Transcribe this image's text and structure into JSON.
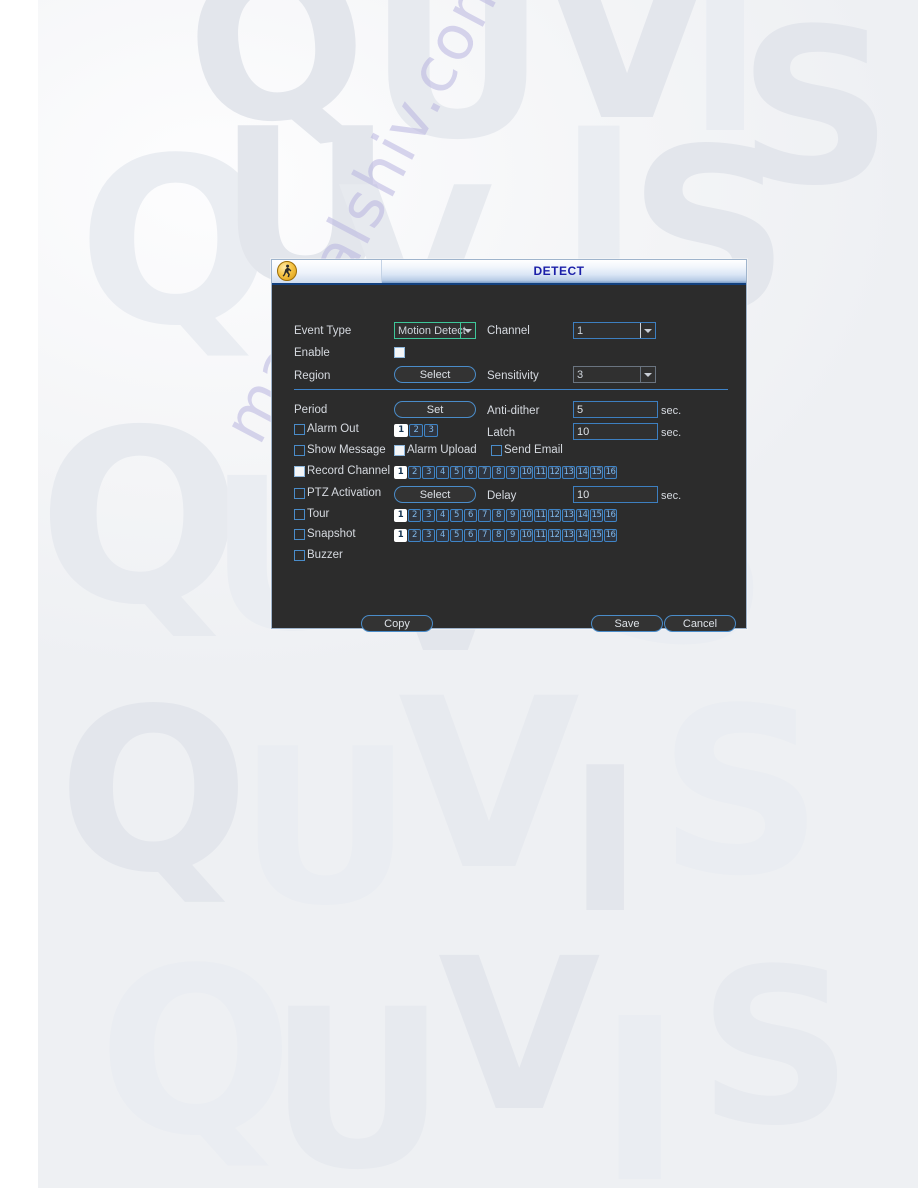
{
  "window": {
    "title": "DETECT",
    "icon": "walking-person-icon",
    "accent_blue": "#3d7fc0",
    "title_text_color": "#1b1fa8",
    "body_bg": "#2c2c2c"
  },
  "page": {
    "background_watermark_text": "QUVIS",
    "site_watermark_text": "manualshiv.com"
  },
  "form": {
    "event_type": {
      "label": "Event Type",
      "value": "Motion Detect"
    },
    "channel": {
      "label": "Channel",
      "value": "1"
    },
    "enable": {
      "label": "Enable",
      "checked": true
    },
    "region": {
      "label": "Region",
      "button": "Select"
    },
    "sensitivity": {
      "label": "Sensitivity",
      "value": "3"
    },
    "period": {
      "label": "Period",
      "button": "Set"
    },
    "anti_dither": {
      "label": "Anti-dither",
      "value": "5",
      "unit": "sec."
    },
    "alarm_out": {
      "label": "Alarm Out",
      "checked": false,
      "channels": [
        "1",
        "2",
        "3"
      ],
      "active": [
        1
      ]
    },
    "latch": {
      "label": "Latch",
      "value": "10",
      "unit": "sec."
    },
    "show_message": {
      "label": "Show Message",
      "checked": false
    },
    "alarm_upload": {
      "label": "Alarm Upload",
      "checked": true
    },
    "send_email": {
      "label": "Send Email",
      "checked": false
    },
    "record_channel": {
      "label": "Record Channel",
      "checked": true,
      "channels": [
        "1",
        "2",
        "3",
        "4",
        "5",
        "6",
        "7",
        "8",
        "9",
        "10",
        "11",
        "12",
        "13",
        "14",
        "15",
        "16"
      ],
      "active": [
        1
      ]
    },
    "ptz_activation": {
      "label": "PTZ Activation",
      "checked": false,
      "button": "Select"
    },
    "delay": {
      "label": "Delay",
      "value": "10",
      "unit": "sec."
    },
    "tour": {
      "label": "Tour",
      "checked": false,
      "channels": [
        "1",
        "2",
        "3",
        "4",
        "5",
        "6",
        "7",
        "8",
        "9",
        "10",
        "11",
        "12",
        "13",
        "14",
        "15",
        "16"
      ],
      "active": [
        1
      ]
    },
    "snapshot": {
      "label": "Snapshot",
      "checked": false,
      "channels": [
        "1",
        "2",
        "3",
        "4",
        "5",
        "6",
        "7",
        "8",
        "9",
        "10",
        "11",
        "12",
        "13",
        "14",
        "15",
        "16"
      ],
      "active": [
        1
      ]
    },
    "buzzer": {
      "label": "Buzzer",
      "checked": false
    }
  },
  "footer": {
    "copy": "Copy",
    "save": "Save",
    "cancel": "Cancel"
  }
}
